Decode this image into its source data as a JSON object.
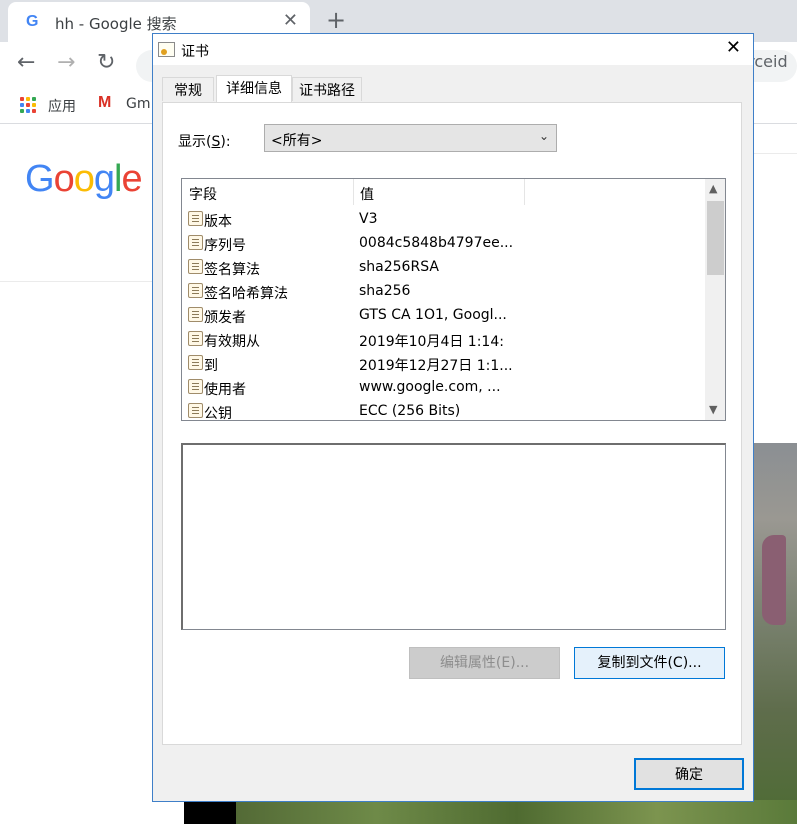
{
  "browser": {
    "tab_title": "hh - Google 搜索",
    "new_tab": "+",
    "tab_close": "✕",
    "nav": {
      "back": "←",
      "forward": "→",
      "reload": "↻"
    },
    "omnibox_fragment": "urceid",
    "bookmarks": [
      {
        "label": "应用"
      },
      {
        "label": "Gm"
      }
    ],
    "page_logo": "Google",
    "logo_colors": [
      "#4285F4",
      "#EA4335",
      "#FBBC05",
      "#4285F4",
      "#34A853",
      "#EA4335"
    ]
  },
  "dialog": {
    "title": "证书",
    "close": "✕",
    "tabs": [
      {
        "label": "常规",
        "active": false
      },
      {
        "label": "详细信息",
        "active": true
      },
      {
        "label": "证书路径",
        "active": false
      }
    ],
    "show_label_pre": "显示(",
    "show_label_key": "S",
    "show_label_post": "):",
    "show_value": "<所有>",
    "columns": {
      "field": "字段",
      "value": "值"
    },
    "rows": [
      {
        "field": "版本",
        "value": "V3"
      },
      {
        "field": "序列号",
        "value": "0084c5848b4797ee..."
      },
      {
        "field": "签名算法",
        "value": "sha256RSA"
      },
      {
        "field": "签名哈希算法",
        "value": "sha256"
      },
      {
        "field": "颁发者",
        "value": "GTS CA 1O1, Googl..."
      },
      {
        "field": "有效期从",
        "value": "2019年10月4日 1:14:"
      },
      {
        "field": "到",
        "value": "2019年12月27日 1:1..."
      },
      {
        "field": "使用者",
        "value": "www.google.com, ..."
      },
      {
        "field": "公钥",
        "value": "ECC (256 Bits)"
      }
    ],
    "buttons": {
      "edit_properties": "编辑属性(E)...",
      "copy_to_file": "复制到文件(C)...",
      "ok": "确定"
    }
  }
}
